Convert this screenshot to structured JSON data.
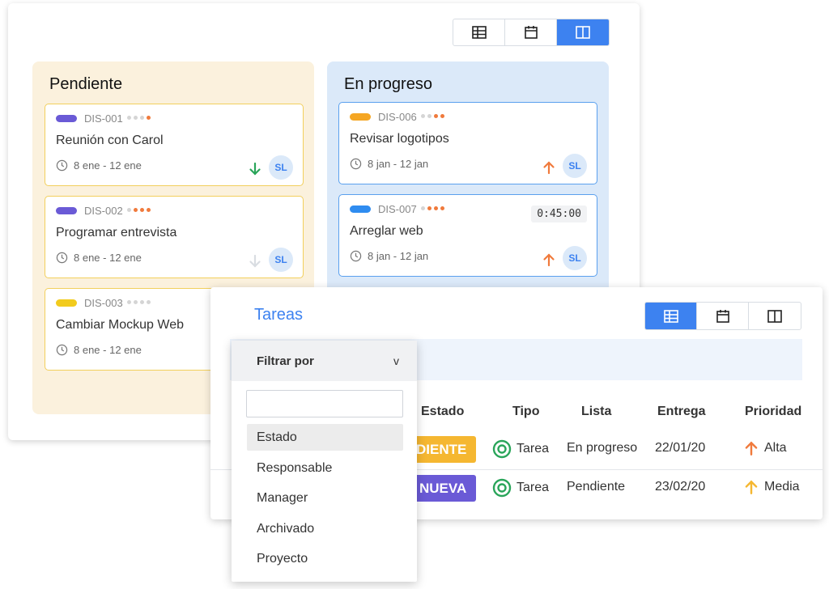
{
  "kanban_view_switch": [
    "table-view",
    "calendar-view",
    "board-view"
  ],
  "columns": [
    {
      "title": "Pendiente",
      "cards": [
        {
          "code": "DIS-001",
          "title": "Reunión con Carol",
          "date": "8 ene - 12 ene",
          "tag_color": "#6a5ad6",
          "dots_on": 1,
          "priority": "down",
          "priority_color": "#2aa55a",
          "avatar": "SL"
        },
        {
          "code": "DIS-002",
          "title": "Programar entrevista",
          "date": "8 ene - 12 ene",
          "tag_color": "#6a5ad6",
          "dots_on": 3,
          "priority": "down",
          "priority_color": "#d9dde2",
          "avatar": "SL"
        },
        {
          "code": "DIS-003",
          "title": "Cambiar Mockup Web",
          "date": "8 ene - 12 ene",
          "tag_color": "#f2cb1d",
          "dots_on": 0
        }
      ]
    },
    {
      "title": "En progreso",
      "cards": [
        {
          "code": "DIS-006",
          "title": "Revisar logotipos",
          "date": "8 jan - 12 jan",
          "tag_color": "#f5a623",
          "dots_on": 2,
          "priority": "up",
          "priority_color": "#f07a3c",
          "avatar": "SL"
        },
        {
          "code": "DIS-007",
          "title": "Arreglar web",
          "date": "8 jan - 12 jan",
          "tag_color": "#2f8cf0",
          "dots_on": 3,
          "priority": "up",
          "priority_color": "#f07a3c",
          "avatar": "SL",
          "timer": "0:45:00"
        }
      ]
    }
  ],
  "table": {
    "title": "Tareas",
    "headers": {
      "estado": "Estado",
      "tipo": "Tipo",
      "lista": "Lista",
      "entrega": "Entrega",
      "prioridad": "Prioridad"
    },
    "rows": [
      {
        "estado": "PENDIENTE",
        "estado_visible": "DIENTE",
        "estado_color": "#f5b731",
        "tipo": "Tarea",
        "lista": "En progreso",
        "entrega": "22/01/20",
        "prioridad": "Alta",
        "prioridad_color": "#f07a3c"
      },
      {
        "estado": "NUEVA",
        "estado_visible": "NUEVA",
        "estado_color": "#6a5ad6",
        "tipo": "Tarea",
        "lista": "Pendiente",
        "entrega": "23/02/20",
        "prioridad": "Media",
        "prioridad_color": "#f5b731"
      }
    ]
  },
  "dropdown": {
    "label": "Filtrar por",
    "chevron": "v",
    "search_value": "",
    "options": [
      "Estado",
      "Responsable",
      "Manager",
      "Archivado",
      "Proyecto"
    ],
    "selected": "Estado"
  },
  "colors": {
    "accent": "#3d82f0",
    "pending_bg": "#fbf1dd",
    "progress_bg": "#dbe9f9",
    "type_icon": "#2aa55a"
  }
}
